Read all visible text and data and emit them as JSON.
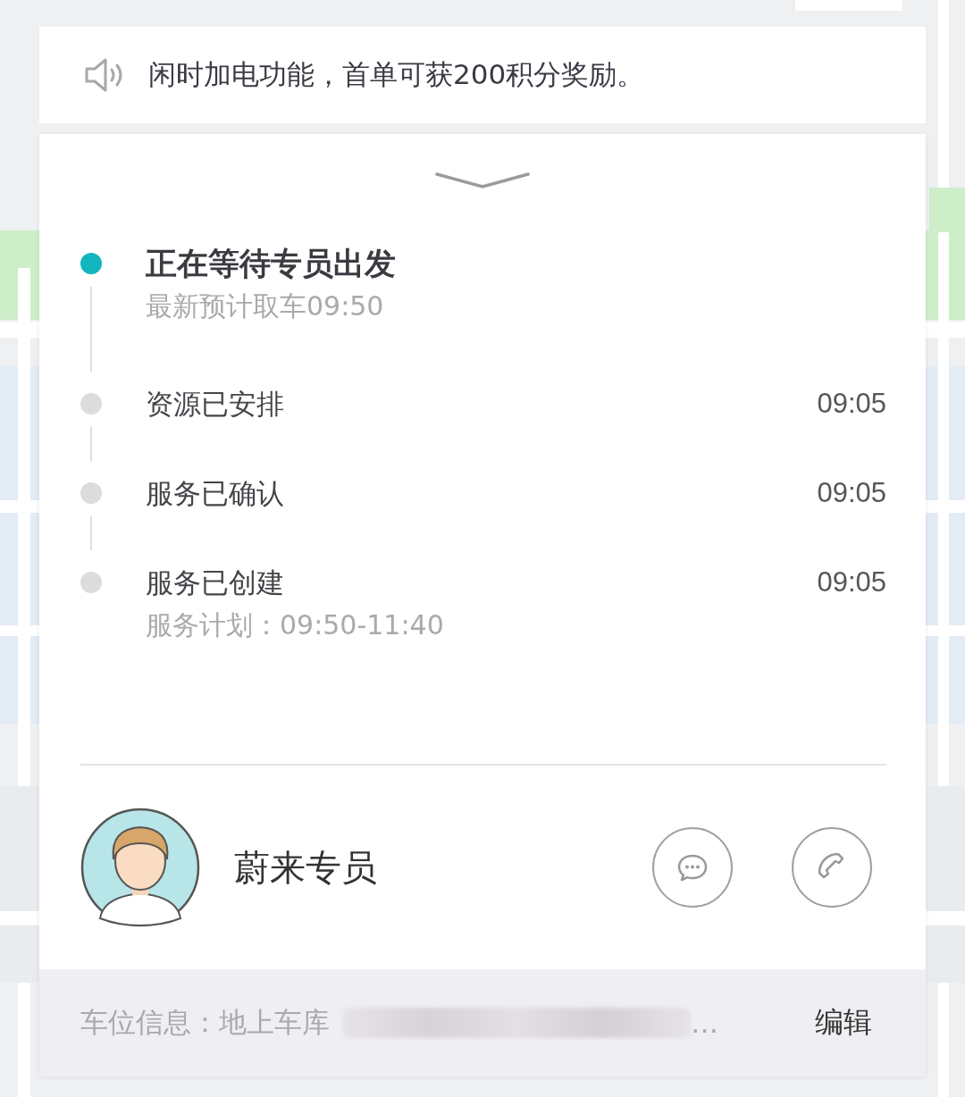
{
  "notice": {
    "text": "闲时加电功能，首单可获200积分奖励。"
  },
  "steps": [
    {
      "title": "正在等待专员出发",
      "subtitle": "最新预计取车09:50",
      "active": true
    },
    {
      "title": "资源已安排",
      "time": "09:05",
      "active": false
    },
    {
      "title": "服务已确认",
      "time": "09:05",
      "active": false
    },
    {
      "title": "服务已创建",
      "subtitle": "服务计划：09:50-11:40",
      "time": "09:05",
      "active": false
    }
  ],
  "contact": {
    "name": "蔚来专员"
  },
  "parking": {
    "label": "车位信息：地上车库",
    "ellipsis": "…",
    "edit": "编辑"
  }
}
